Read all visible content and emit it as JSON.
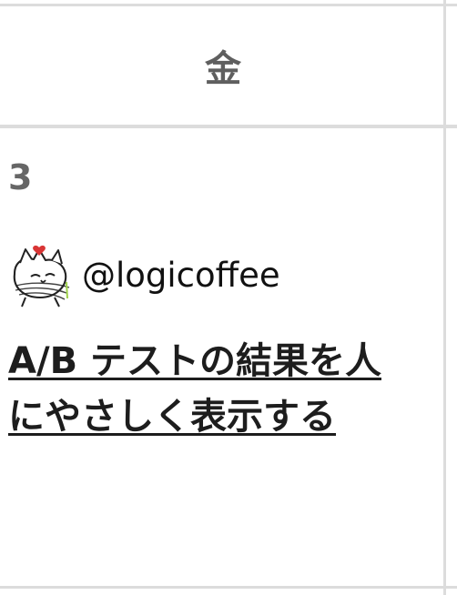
{
  "calendar": {
    "day_header": "金",
    "date": "3"
  },
  "entry": {
    "author_handle": "@logicoffee",
    "avatar_icon": "cat-avatar-icon",
    "title": "A/B テストの結果を人にやさしく表示する"
  },
  "colors": {
    "border": "#dcdcdc",
    "header_text": "#5f5f5f",
    "date_text": "#666666",
    "title_text": "#1d1d1d",
    "heart": "#d93535"
  }
}
